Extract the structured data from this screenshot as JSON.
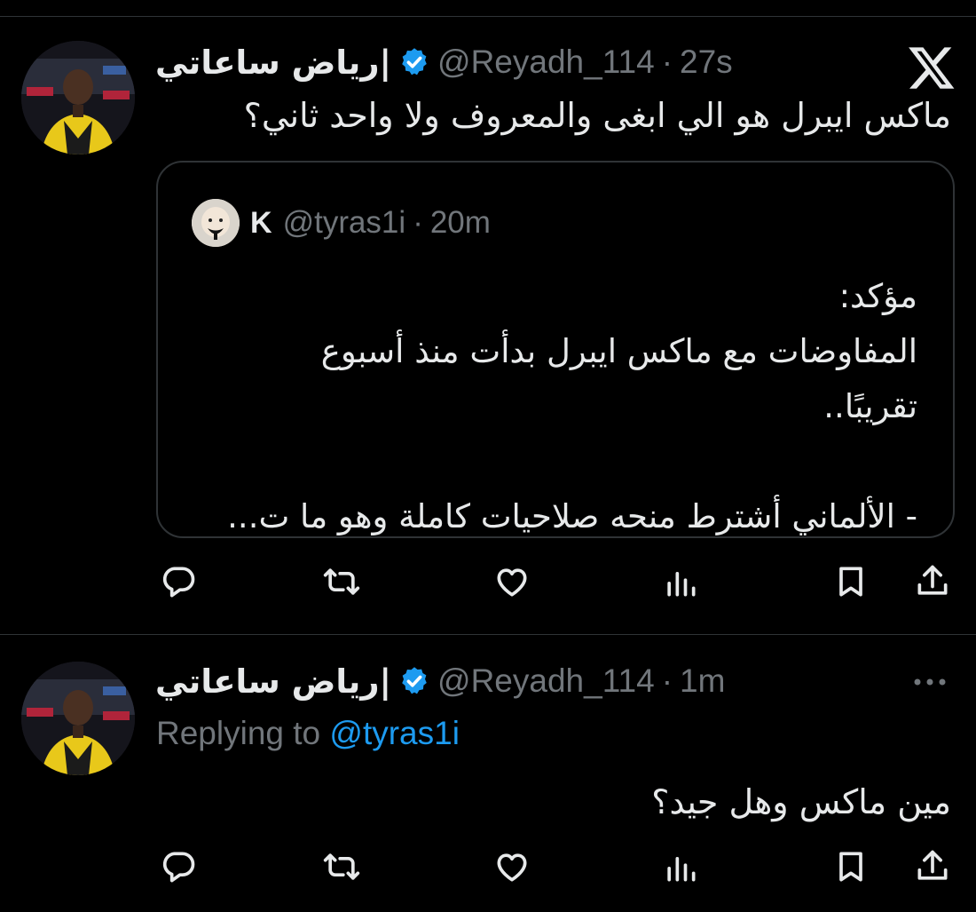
{
  "tweet1": {
    "display_name": "رياض ساعاتي|",
    "handle": "@Reyadh_114",
    "separator": "·",
    "time": "27s",
    "text": "ماكس ايبرل هو الي ابغى والمعروف ولا واحد ثاني؟",
    "quote": {
      "name": "K",
      "handle": "@tyras1i",
      "separator": "·",
      "time": "20m",
      "lines": [
        "مؤكد:",
        "المفاوضات مع ماكس ايبرل بدأت منذ أسبوع",
        "تقريبًا..",
        "",
        "- الألماني أشترط منحه صلاحيات كاملة وهو ما ت..."
      ]
    }
  },
  "tweet2": {
    "display_name": "رياض ساعاتي|",
    "handle": "@Reyadh_114",
    "separator": "·",
    "time": "1m",
    "replying_prefix": "Replying to",
    "replying_mention": "@tyras1i",
    "text": "مين ماكس وهل جيد؟"
  },
  "icons": {
    "reply": "speech-bubble-icon",
    "retweet": "retweet-icon",
    "like": "heart-icon",
    "views": "bar-chart-icon",
    "bookmark": "bookmark-icon",
    "share": "share-icon",
    "brand": "x-logo-icon",
    "more": "more-dots-icon",
    "verified": "verified-badge-icon"
  },
  "colors": {
    "background": "#000000",
    "text": "#e7e9ea",
    "secondary": "#71767b",
    "accent": "#1d9bf0",
    "border": "#2f3336"
  }
}
